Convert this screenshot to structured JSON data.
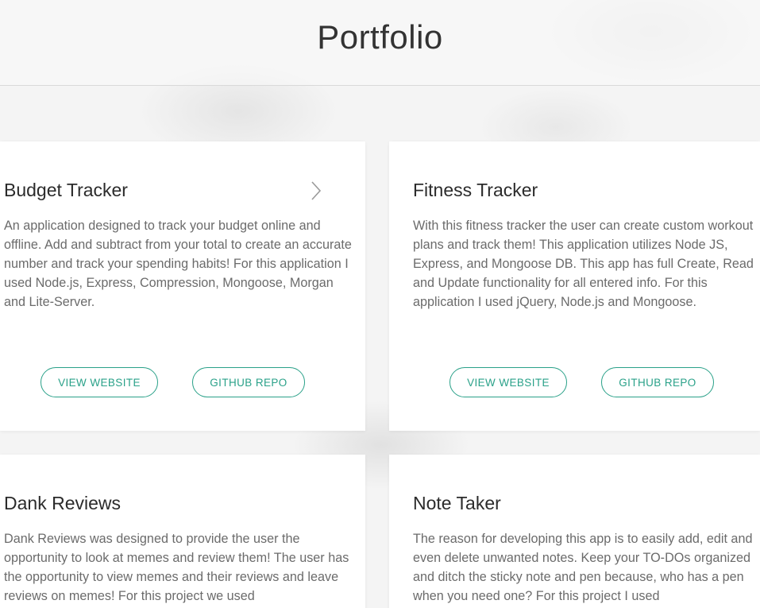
{
  "header": {
    "title": "Portfolio"
  },
  "projects": [
    {
      "title": "Budget Tracker",
      "description": "An application designed to track your budget online and offline. Add and subtract from your total to create an accurate number and track your spending habits! For this application I used Node.js, Express, Compression, Mongoose, Morgan and Lite-Server.",
      "website_label": "VIEW WEBSITE",
      "repo_label": "GITHUB REPO"
    },
    {
      "title": "Fitness Tracker",
      "description": "With this fitness tracker the user can create custom workout plans and track them! This application utilizes Node JS, Express, and Mongoose DB. This app has full Create, Read and Update functionality for all entered info. For this application I used jQuery, Node.js and Mongoose.",
      "website_label": "VIEW WEBSITE",
      "repo_label": "GITHUB REPO"
    },
    {
      "title": "Dank Reviews",
      "description": "Dank Reviews was designed to provide the user the opportunity to look at memes and review them! The user has the opportunity to view memes and their reviews and leave reviews on memes! For this project we used"
    },
    {
      "title": "Note Taker",
      "description": "The reason for developing this app is to easily add, edit and even delete unwanted notes. Keep your TO-DOs organized and ditch the sticky note and pen because, who has a pen when you need one? For this project I used"
    }
  ],
  "colors": {
    "accent": "#2aa189",
    "background": "#f4f4f4",
    "card": "#ffffff",
    "text": "#333333",
    "muted_text": "#6b6b6b"
  },
  "icons": {
    "card_arrow": "chevron-right-icon"
  }
}
